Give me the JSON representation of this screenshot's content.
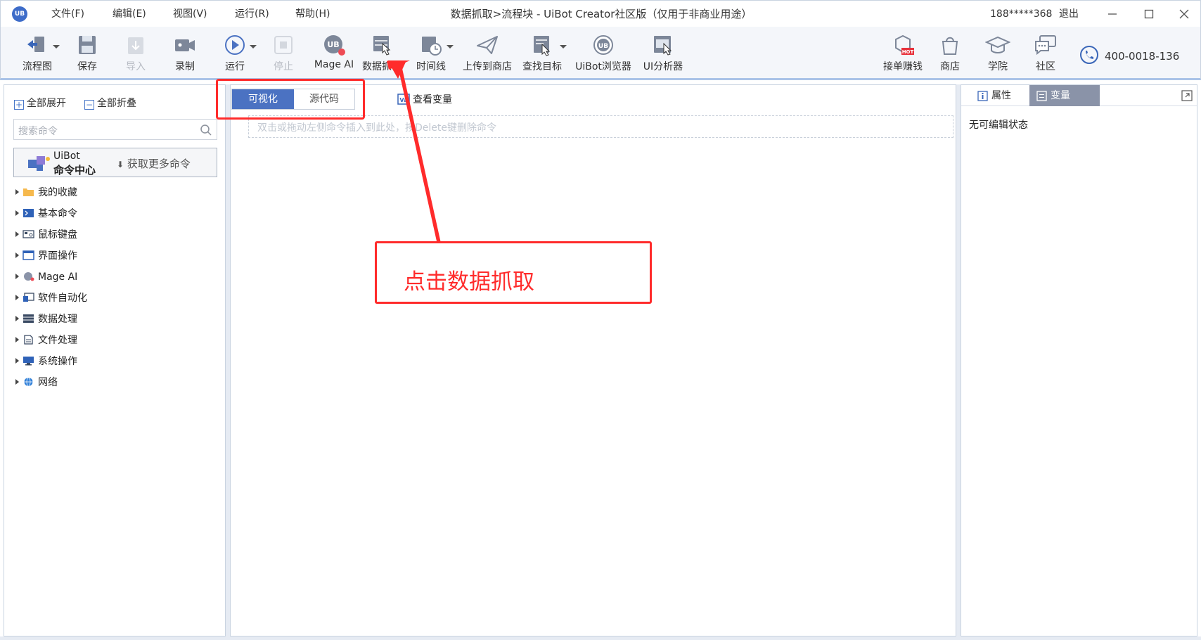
{
  "titlebar": {
    "logo_text": "UB",
    "menus": [
      "文件(F)",
      "编辑(E)",
      "视图(V)",
      "运行(R)",
      "帮助(H)"
    ],
    "window_title": "数据抓取>流程块 - UiBot Creator社区版（仅用于非商业用途）",
    "user": "188*****368",
    "logout": "退出"
  },
  "toolbar": {
    "left_tools": [
      {
        "label": "流程图",
        "icon": "flowchart-icon",
        "dropdown": true,
        "disabled": false
      },
      {
        "label": "保存",
        "icon": "save-icon",
        "dropdown": false,
        "disabled": false
      },
      {
        "label": "导入",
        "icon": "import-icon",
        "dropdown": false,
        "disabled": true
      },
      {
        "label": "录制",
        "icon": "record-icon",
        "dropdown": false,
        "disabled": false
      },
      {
        "label": "运行",
        "icon": "run-icon",
        "dropdown": true,
        "disabled": false
      },
      {
        "label": "停止",
        "icon": "stop-icon",
        "dropdown": false,
        "disabled": true
      },
      {
        "label": "Mage AI",
        "icon": "mage-ai-icon",
        "dropdown": false,
        "disabled": false
      },
      {
        "label": "数据抓取",
        "icon": "data-scraping-icon",
        "dropdown": false,
        "disabled": false
      },
      {
        "label": "时间线",
        "icon": "timeline-icon",
        "dropdown": true,
        "disabled": false
      },
      {
        "label": "上传到商店",
        "icon": "upload-icon",
        "dropdown": false,
        "disabled": false
      },
      {
        "label": "查找目标",
        "icon": "find-target-icon",
        "dropdown": true,
        "disabled": false
      },
      {
        "label": "UiBot浏览器",
        "icon": "uibot-browser-icon",
        "dropdown": false,
        "disabled": false
      },
      {
        "label": "UI分析器",
        "icon": "ui-analyzer-icon",
        "dropdown": false,
        "disabled": false
      }
    ],
    "right_tools": [
      {
        "label": "接单赚钱",
        "icon": "earn-money-icon",
        "badge": "HOT"
      },
      {
        "label": "商店",
        "icon": "store-icon"
      },
      {
        "label": "学院",
        "icon": "academy-icon"
      },
      {
        "label": "社区",
        "icon": "community-icon"
      }
    ],
    "phone": "400-0018-136"
  },
  "left_pane": {
    "expand_all": "全部展开",
    "collapse_all": "全部折叠",
    "search_placeholder": "搜索命令",
    "command_center": {
      "line1": "UiBot",
      "line2": "命令中心",
      "more": "获取更多命令"
    },
    "tree": [
      {
        "label": "我的收藏",
        "icon": "folder-icon"
      },
      {
        "label": "基本命令",
        "icon": "terminal-icon"
      },
      {
        "label": "鼠标键盘",
        "icon": "mouse-keyboard-icon"
      },
      {
        "label": "界面操作",
        "icon": "window-icon"
      },
      {
        "label": "Mage AI",
        "icon": "mage-ai-icon"
      },
      {
        "label": "软件自动化",
        "icon": "software-automation-icon"
      },
      {
        "label": "数据处理",
        "icon": "data-table-icon"
      },
      {
        "label": "文件处理",
        "icon": "file-icon"
      },
      {
        "label": "系统操作",
        "icon": "system-icon"
      },
      {
        "label": "网络",
        "icon": "globe-icon"
      }
    ]
  },
  "center": {
    "tab_visual": "可视化",
    "tab_source": "源代码",
    "view_vars": "查看变量",
    "dropzone_hint": "双击或拖动左侧命令插入到此处，按Delete键删除命令"
  },
  "right_pane": {
    "tab_props": "属性",
    "tab_vars": "变量",
    "status": "无可编辑状态"
  },
  "annotation": {
    "callout_text": "点击数据抓取",
    "color": "#ff2b2b"
  },
  "colors": {
    "accent": "#4b72c2",
    "toolbar_bg": "#f4f6fa",
    "panel_border": "#c9d3e0"
  }
}
